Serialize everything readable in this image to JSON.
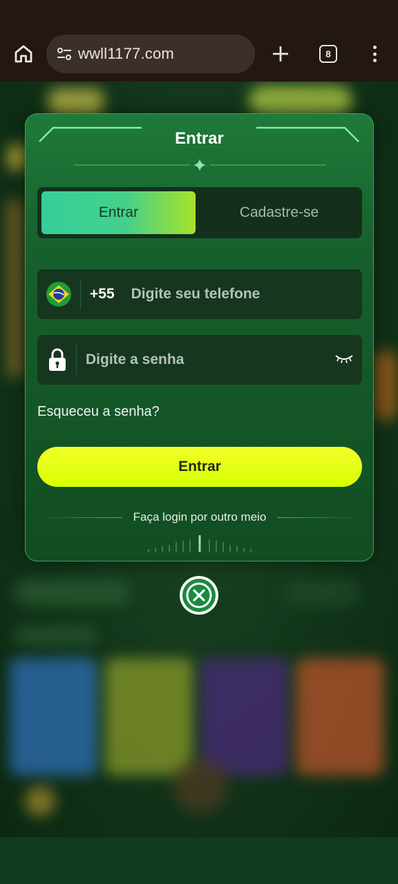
{
  "browser": {
    "url": "wwll1177.com",
    "tab_count": "8"
  },
  "modal": {
    "title": "Entrar",
    "tabs": [
      {
        "label": "Entrar",
        "active": true
      },
      {
        "label": "Cadastre-se",
        "active": false
      }
    ],
    "phone": {
      "country_code": "+55",
      "placeholder": "Digite seu telefone"
    },
    "password": {
      "placeholder": "Digite a senha"
    },
    "forgot_label": "Esqueceu a senha?",
    "submit_label": "Entrar",
    "other_login_label": "Faça login por outro meio"
  },
  "colors": {
    "accent_gradient_start": "#35cf9c",
    "accent_gradient_end": "#a8e22a",
    "button": "#e6ff00",
    "modal": "#1a6b33"
  }
}
